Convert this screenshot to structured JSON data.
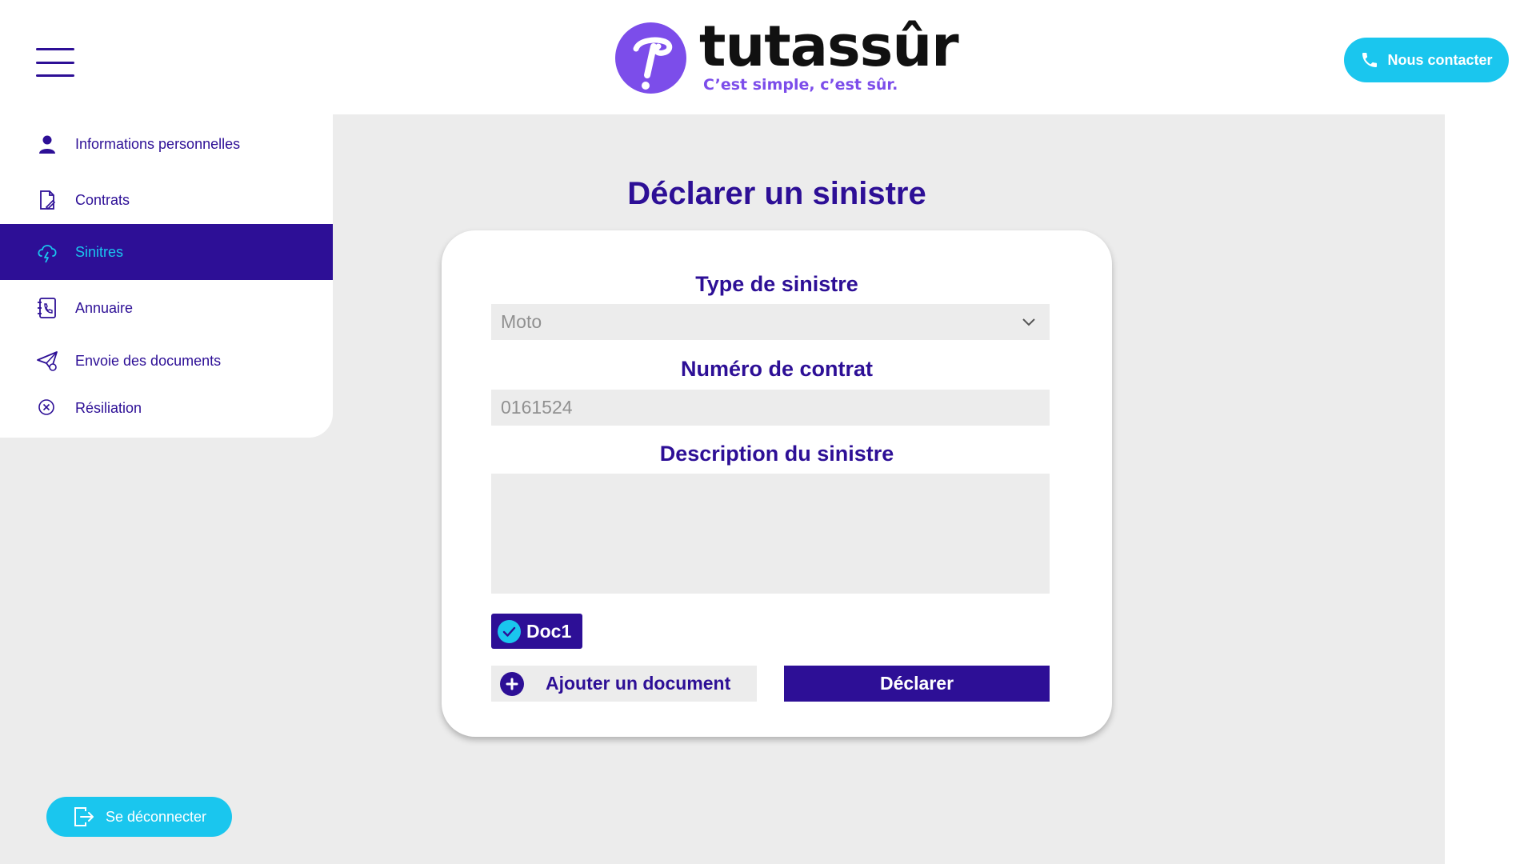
{
  "header": {
    "logo_word": "tutassûr",
    "logo_tagline": "C’est simple, c’est sûr.",
    "contact_label": "Nous contacter"
  },
  "sidebar": {
    "items": [
      {
        "label": "Informations personnelles",
        "icon": "user-icon"
      },
      {
        "label": "Contrats",
        "icon": "document-edit-icon"
      },
      {
        "label": "Sinitres",
        "icon": "storm-cloud-icon",
        "active": true
      },
      {
        "label": "Annuaire",
        "icon": "phone-book-icon"
      },
      {
        "label": "Envoie des documents",
        "icon": "paper-plane-icon"
      },
      {
        "label": "Résiliation",
        "icon": "close-circle-icon"
      }
    ],
    "logout_label": "Se déconnecter"
  },
  "form": {
    "title": "Déclarer un sinistre",
    "type_label": "Type de sinistre",
    "type_value": "Moto",
    "contract_label": "Numéro de contrat",
    "contract_value": "0161524",
    "description_label": "Description du sinistre",
    "description_value": "",
    "document_chip": "Doc1",
    "add_document_label": "Ajouter un document",
    "submit_label": "Déclarer"
  },
  "colors": {
    "primary": "#2d0f96",
    "accent": "#1ac6ee",
    "logo_purple": "#7c4dea",
    "background": "#ececec"
  }
}
